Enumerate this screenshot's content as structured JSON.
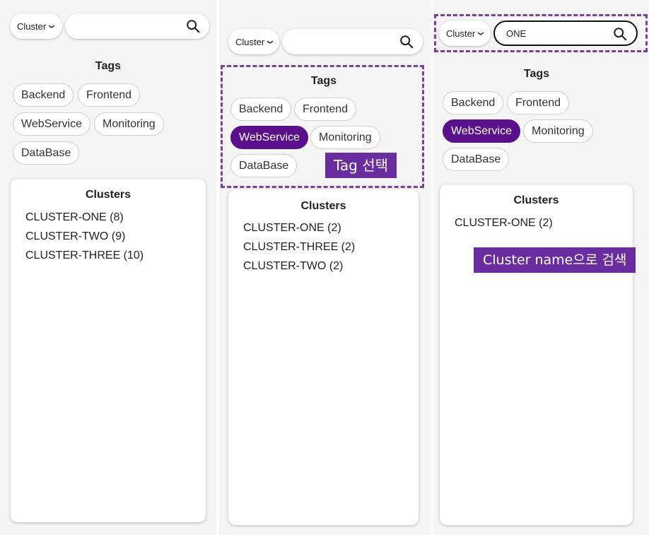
{
  "colors": {
    "accent": "#5a0f8c",
    "callout": "#6a2da0",
    "highlight_border": "#7a3ea0"
  },
  "icons": {
    "search": "search-icon",
    "dropdown": "chevron-down-icon"
  },
  "panel1": {
    "select_value": "Cluster",
    "search_value": "",
    "tags_title": "Tags",
    "tags": [
      {
        "label": "Backend",
        "selected": false
      },
      {
        "label": "Frontend",
        "selected": false
      },
      {
        "label": "WebService",
        "selected": false
      },
      {
        "label": "Monitoring",
        "selected": false
      },
      {
        "label": "DataBase",
        "selected": false
      }
    ],
    "clusters_title": "Clusters",
    "clusters": [
      "CLUSTER-ONE (8)",
      "CLUSTER-TWO (9)",
      "CLUSTER-THREE (10)"
    ]
  },
  "panel2": {
    "select_value": "Cluster",
    "search_value": "",
    "tags_title": "Tags",
    "tags": [
      {
        "label": "Backend",
        "selected": false
      },
      {
        "label": "Frontend",
        "selected": false
      },
      {
        "label": "WebService",
        "selected": true
      },
      {
        "label": "Monitoring",
        "selected": false
      },
      {
        "label": "DataBase",
        "selected": false
      }
    ],
    "callout": "Tag 선택",
    "clusters_title": "Clusters",
    "clusters": [
      "CLUSTER-ONE (2)",
      "CLUSTER-THREE (2)",
      "CLUSTER-TWO (2)"
    ]
  },
  "panel3": {
    "select_value": "Cluster",
    "search_value": "ONE",
    "tags_title": "Tags",
    "tags": [
      {
        "label": "Backend",
        "selected": false
      },
      {
        "label": "Frontend",
        "selected": false
      },
      {
        "label": "WebService",
        "selected": true
      },
      {
        "label": "Monitoring",
        "selected": false
      },
      {
        "label": "DataBase",
        "selected": false
      }
    ],
    "callout": "Cluster name으로 검색",
    "clusters_title": "Clusters",
    "clusters": [
      "CLUSTER-ONE (2)"
    ]
  }
}
